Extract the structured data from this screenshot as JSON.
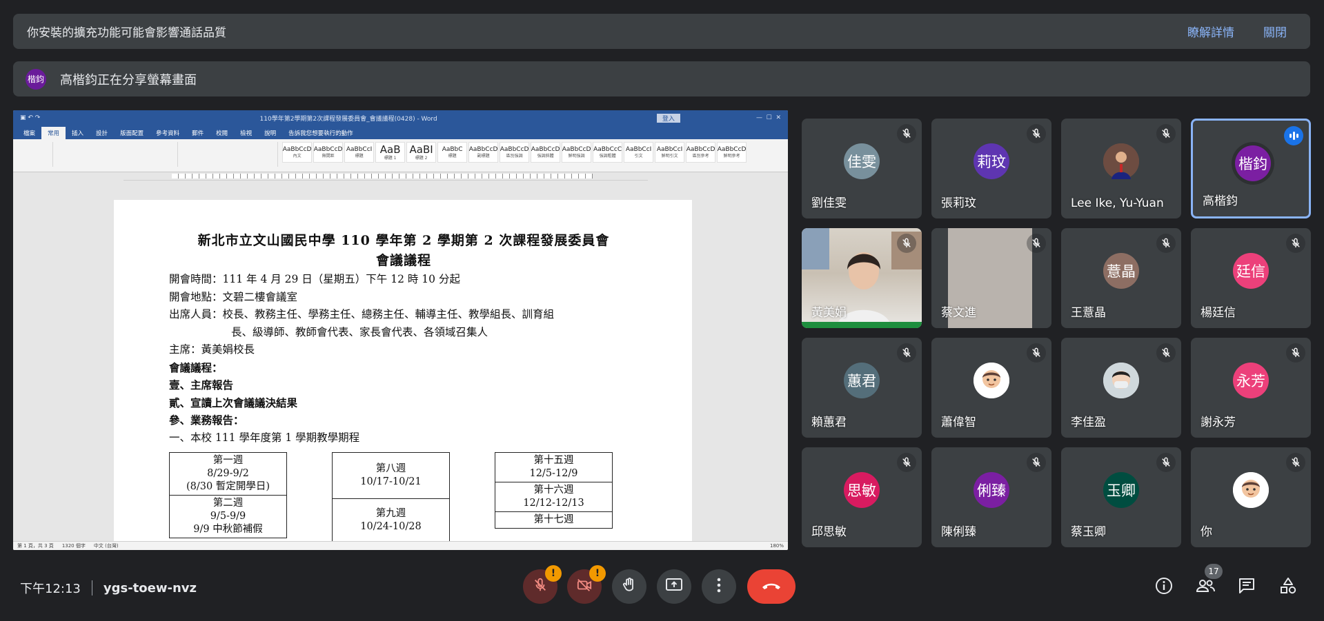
{
  "banners": {
    "extension": {
      "message": "你安裝的擴充功能可能會影響通話品質",
      "learn_more": "瞭解詳情",
      "close": "關閉"
    },
    "share": {
      "avatar": "楷鈞",
      "message": "高楷鈞正在分享螢幕畫面"
    }
  },
  "shared_doc": {
    "window_title": "110學年第2學期第2次課程發展委員會_會議議程(0428) - Word",
    "sign_in": "登入",
    "tabs": [
      "檔案",
      "常用",
      "插入",
      "設計",
      "版面配置",
      "參考資料",
      "郵件",
      "校閱",
      "檢視",
      "說明",
      "告訴我您想要執行的動作"
    ],
    "styles": [
      {
        "sample": "AaBbCcD",
        "name": "內文"
      },
      {
        "sample": "AaBbCcD",
        "name": "無間距"
      },
      {
        "sample": "AaBbCcI",
        "name": "標題"
      },
      {
        "sample": "AaB",
        "name": "標題 1"
      },
      {
        "sample": "AaBI",
        "name": "標題 2"
      },
      {
        "sample": "AaBbC",
        "name": "標題"
      },
      {
        "sample": "AaBbCcD",
        "name": "副標題"
      },
      {
        "sample": "AaBbCcD",
        "name": "區別強調"
      },
      {
        "sample": "AaBbCcD",
        "name": "強調斜體"
      },
      {
        "sample": "AaBbCcD",
        "name": "鮮明強調"
      },
      {
        "sample": "AaBbCcC",
        "name": "強調粗體"
      },
      {
        "sample": "AaBbCcI",
        "name": "引文"
      },
      {
        "sample": "AaBbCcI",
        "name": "鮮明引文"
      },
      {
        "sample": "AaBbCcD",
        "name": "區別參考"
      },
      {
        "sample": "AaBbCcD",
        "name": "鮮明參考"
      }
    ],
    "title_line1": "新北市立文山國民中學 110 學年第 2 學期第 2 次課程發展委員會",
    "title_line2": "會議議程",
    "lines": [
      "開會時間：111 年 4 月 29 日（星期五）下午 12 時 10 分起",
      "開會地點：文碧二樓會議室",
      "出席人員：校長、教務主任、學務主任、總務主任、輔導主任、教學組長、訓育組",
      "長、級導師、教師會代表、家長會代表、各領域召集人",
      "主席：黃美娟校長",
      "會議議程：",
      "壹、主席報告",
      "貳、宣讀上次會議議決結果",
      "參、業務報告：",
      "一、本校 111 學年度第 1 學期教學期程"
    ],
    "table_col1": [
      {
        "week": "第一週",
        "dates": "8/29-9/2",
        "note": "(8/30 暫定開學日)"
      },
      {
        "week": "第二週",
        "dates": "9/5-9/9",
        "note": "9/9 中秋節補假"
      }
    ],
    "table_col2": [
      {
        "week": "第八週",
        "dates": "10/17-10/21"
      },
      {
        "week": "第九週",
        "dates": "10/24-10/28"
      }
    ],
    "table_col3": [
      {
        "week": "第十五週",
        "dates": "12/5-12/9"
      },
      {
        "week": "第十六週",
        "dates": "12/12-12/13"
      },
      {
        "week": "第十七週",
        "dates": ""
      }
    ],
    "status_page": "第 1 頁，共 3 頁",
    "status_words": "1320 個字",
    "status_lang": "中文 (台灣)",
    "zoom": "180%"
  },
  "participants": [
    {
      "name": "劉佳雯",
      "avatar": "佳雯",
      "color": "#78909c"
    },
    {
      "name": "張莉玟",
      "avatar": "莉玟",
      "color": "#5e35b1"
    },
    {
      "name": "Lee Ike, Yu-Yuan",
      "avatar": "",
      "color": "#795548"
    },
    {
      "name": "高楷鈞",
      "avatar": "楷鈞",
      "color": "#7b1fa2"
    },
    {
      "name": "黃美娟",
      "avatar": "",
      "color": "#8d6e63"
    },
    {
      "name": "蔡文進",
      "avatar": "",
      "color": "#9e9e9e"
    },
    {
      "name": "王薏晶",
      "avatar": "薏晶",
      "color": "#8d6e63"
    },
    {
      "name": "楊廷信",
      "avatar": "廷信",
      "color": "#ec407a"
    },
    {
      "name": "賴蕙君",
      "avatar": "蕙君",
      "color": "#546e7a"
    },
    {
      "name": "蕭偉智",
      "avatar": "",
      "color": "#f5f5f5"
    },
    {
      "name": "李佳盈",
      "avatar": "",
      "color": "#cfd8dc"
    },
    {
      "name": "謝永芳",
      "avatar": "永芳",
      "color": "#ec407a"
    },
    {
      "name": "邱思敏",
      "avatar": "思敏",
      "color": "#d81b60"
    },
    {
      "name": "陳俐臻",
      "avatar": "俐臻",
      "color": "#7b1fa2"
    },
    {
      "name": "蔡玉卿",
      "avatar": "玉卿",
      "color": "#004d40"
    },
    {
      "name": "你",
      "avatar": "",
      "color": "#f5f5f5"
    }
  ],
  "bottom": {
    "time": "下午12:13",
    "meeting_code": "ygs-toew-nvz",
    "mic_badge": "!",
    "cam_badge": "!",
    "people_count": "17"
  },
  "colors": {
    "accent": "#8ab4f8",
    "hangup": "#ea4335",
    "warning": "#f29900",
    "word_blue": "#2b579a"
  }
}
